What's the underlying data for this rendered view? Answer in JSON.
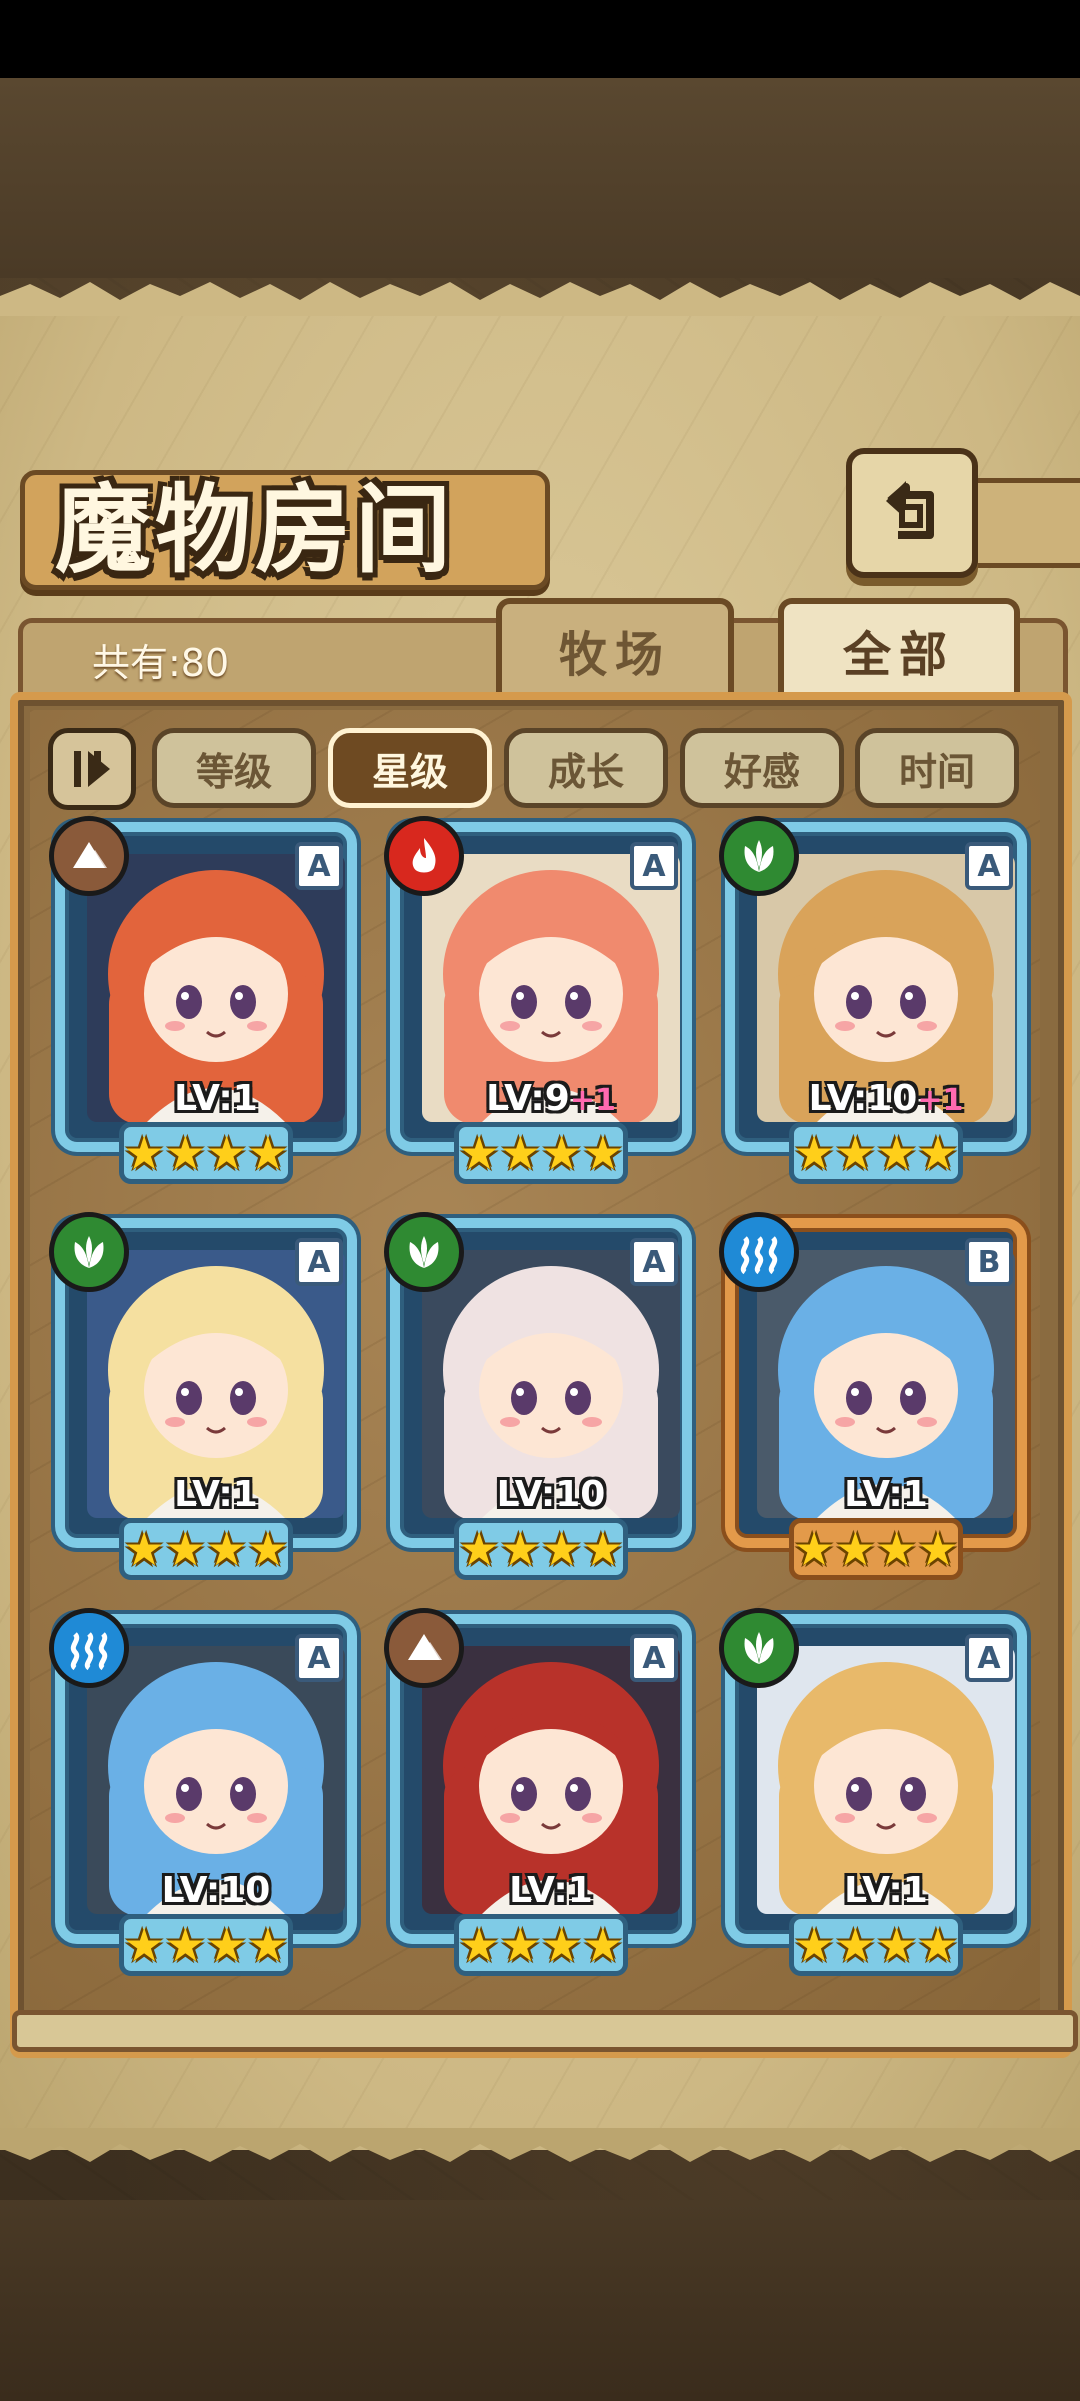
{
  "header": {
    "title": "魔物房间",
    "back_icon": "return-icon"
  },
  "summary": {
    "count_label": "共有:80"
  },
  "tabs": [
    {
      "label": "牧场",
      "active": false
    },
    {
      "label": "全部",
      "active": true
    }
  ],
  "filters": [
    {
      "label": "等级",
      "active": false
    },
    {
      "label": "星级",
      "active": true
    },
    {
      "label": "成长",
      "active": false
    },
    {
      "label": "好感",
      "active": false
    },
    {
      "label": "时间",
      "active": false
    }
  ],
  "cards": [
    {
      "element": "earth",
      "element_color": "#8a5a3a",
      "rank": "A",
      "level": "LV:1",
      "plus": "",
      "stars": 4,
      "frame": "blue",
      "hair": "#e2643c",
      "bg": "#2e3c5a"
    },
    {
      "element": "fire",
      "element_color": "#d8281e",
      "rank": "A",
      "level": "LV:9",
      "plus": "+1",
      "stars": 4,
      "frame": "blue",
      "hair": "#f08a6e",
      "bg": "#e9dcc4"
    },
    {
      "element": "nature",
      "element_color": "#2f8a32",
      "rank": "A",
      "level": "LV:10",
      "plus": "+1",
      "stars": 4,
      "frame": "blue",
      "hair": "#d9a35a",
      "bg": "#d8c8a8"
    },
    {
      "element": "nature",
      "element_color": "#2f8a32",
      "rank": "A",
      "level": "LV:1",
      "plus": "",
      "stars": 4,
      "frame": "blue",
      "hair": "#f5e0a0",
      "bg": "#3a5a8a"
    },
    {
      "element": "nature",
      "element_color": "#2f8a32",
      "rank": "A",
      "level": "LV:10",
      "plus": "",
      "stars": 4,
      "frame": "blue",
      "hair": "#efe2e2",
      "bg": "#3a4a5e"
    },
    {
      "element": "water",
      "element_color": "#1f8ad6",
      "rank": "B",
      "level": "LV:1",
      "plus": "",
      "stars": 4,
      "frame": "bronze",
      "hair": "#6ab0e6",
      "bg": "#4a5a6a"
    },
    {
      "element": "water",
      "element_color": "#1f8ad6",
      "rank": "A",
      "level": "LV:10",
      "plus": "",
      "stars": 4,
      "frame": "blue",
      "hair": "#6ab0e6",
      "bg": "#3a4a5a"
    },
    {
      "element": "earth",
      "element_color": "#8a5a3a",
      "rank": "A",
      "level": "LV:1",
      "plus": "",
      "stars": 4,
      "frame": "blue",
      "hair": "#b8322a",
      "bg": "#3a3040"
    },
    {
      "element": "nature",
      "element_color": "#2f8a32",
      "rank": "A",
      "level": "LV:1",
      "plus": "",
      "stars": 4,
      "frame": "blue",
      "hair": "#e8b96a",
      "bg": "#dfe6ee"
    }
  ]
}
